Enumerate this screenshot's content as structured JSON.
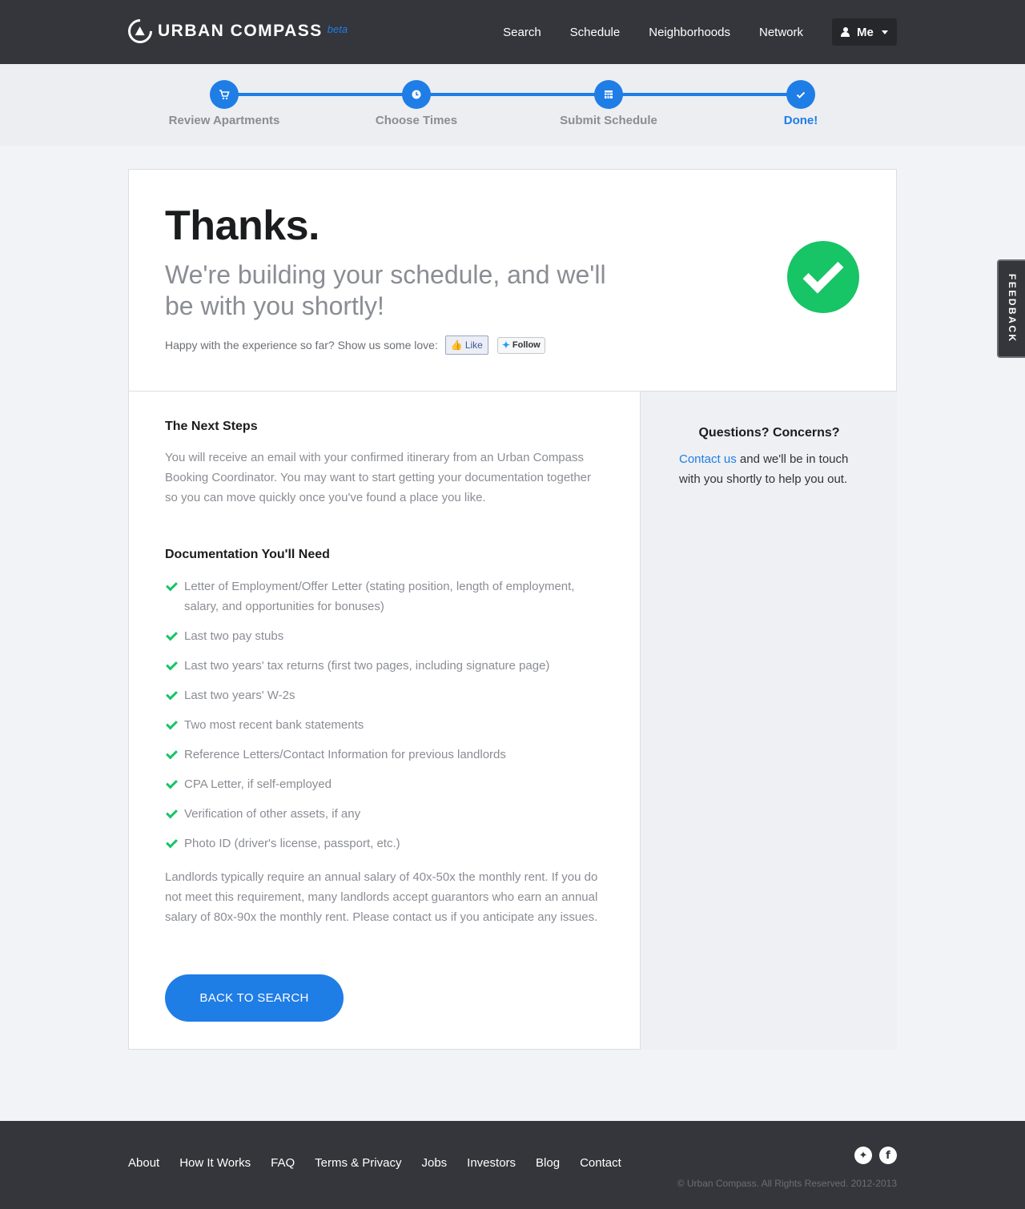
{
  "header": {
    "brand": "URBAN COMPASS",
    "beta": "beta",
    "nav": [
      "Search",
      "Schedule",
      "Neighborhoods",
      "Network"
    ],
    "me_label": "Me"
  },
  "progress": {
    "steps": [
      {
        "label": "Review Apartments",
        "icon": "cart-icon"
      },
      {
        "label": "Choose Times",
        "icon": "clock-icon"
      },
      {
        "label": "Submit Schedule",
        "icon": "calendar-icon"
      },
      {
        "label": "Done!",
        "icon": "check-icon"
      }
    ],
    "active_color": "#1f7de6"
  },
  "hero": {
    "title": "Thanks.",
    "subtitle": "We're building your schedule, and we'll be with you shortly!",
    "love_text": "Happy with the experience so far? Show us some love:",
    "like_label": "Like",
    "follow_label": "Follow",
    "status_color": "#17c466"
  },
  "main": {
    "next_title": "The Next Steps",
    "next_text": "You will receive an email with your confirmed itinerary from an Urban Compass Booking Coordinator. You may want to start getting your documentation together so you can move quickly once you've found a place you like.",
    "docs_title": "Documentation You'll Need",
    "docs": [
      "Letter of Employment/Offer Letter (stating position, length of employment, salary, and opportunities for bonuses)",
      "Last two pay stubs",
      "Last two years' tax returns (first two pages, including signature page)",
      "Last two years' W-2s",
      "Two most recent bank statements",
      "Reference Letters/Contact Information for previous landlords",
      "CPA Letter, if self-employed",
      "Verification of other assets, if any",
      "Photo ID (driver's license, passport, etc.)"
    ],
    "salary_note": "Landlords typically require an annual salary of 40x-50x the monthly rent. If you do not meet this requirement, many landlords accept guarantors who earn an annual salary of 80x-90x the monthly rent. Please contact us if you anticipate any issues.",
    "back_button": "BACK TO SEARCH"
  },
  "side": {
    "title": "Questions? Concerns?",
    "link": "Contact us",
    "text": " and we'll be in touch with you shortly to help you out."
  },
  "feedback": "FEEDBACK",
  "footer": {
    "links": [
      "About",
      "How It Works",
      "FAQ",
      "Terms & Privacy",
      "Jobs",
      "Investors",
      "Blog",
      "Contact"
    ],
    "copyright": "© Urban Compass. All Rights Reserved. 2012-2013",
    "social": [
      "twitter-icon",
      "facebook-icon"
    ]
  }
}
